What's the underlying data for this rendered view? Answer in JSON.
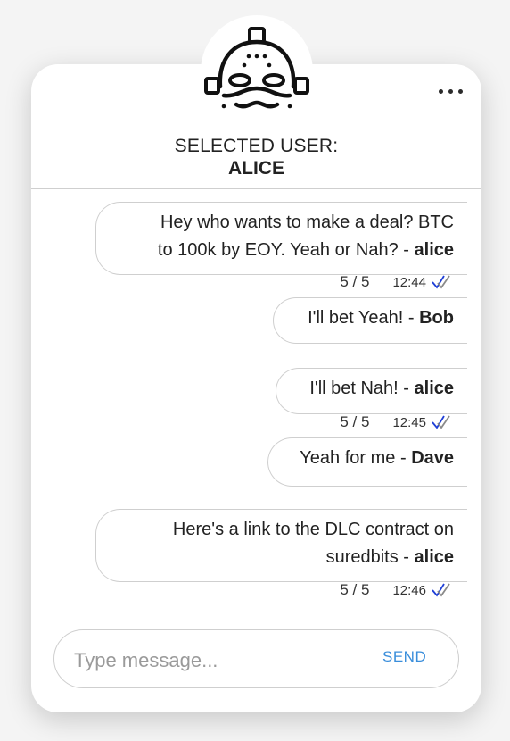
{
  "header": {
    "selected_label": "SELECTED USER:",
    "selected_user": "ALICE",
    "menu_icon": "more-horizontal-icon",
    "avatar_icon": "hockey-mask-avatar-icon"
  },
  "messages": [
    {
      "text": "Hey who wants to make a deal? BTC to 100k by EOY. Yeah or Nah? - ",
      "author": "alice",
      "line1": "Hey who wants to make a deal? BTC",
      "line2": "to 100k by EOY. Yeah or Nah? - ",
      "count": "5 / 5",
      "time": "12:44",
      "has_meta": true
    },
    {
      "text": "I'll bet Yeah! - ",
      "author": "Bob",
      "has_meta": false
    },
    {
      "text": "I'll bet Nah! - ",
      "author": "alice",
      "count": "5 / 5",
      "time": "12:45",
      "has_meta": true
    },
    {
      "text": "Yeah for me - ",
      "author": "Dave",
      "has_meta": false
    },
    {
      "text": "Here's a link to the DLC contract on suredbits - ",
      "author": "alice",
      "line1": "Here's a link to the DLC contract on",
      "line2": "suredbits - ",
      "count": "5 / 5",
      "time": "12:46",
      "has_meta": true
    }
  ],
  "composer": {
    "placeholder": "Type message...",
    "value": "",
    "send_label": "SEND"
  },
  "colors": {
    "accent": "#3a8edb",
    "tick_read": "#1f3fd6",
    "tick_gray": "#8a8a8a"
  }
}
